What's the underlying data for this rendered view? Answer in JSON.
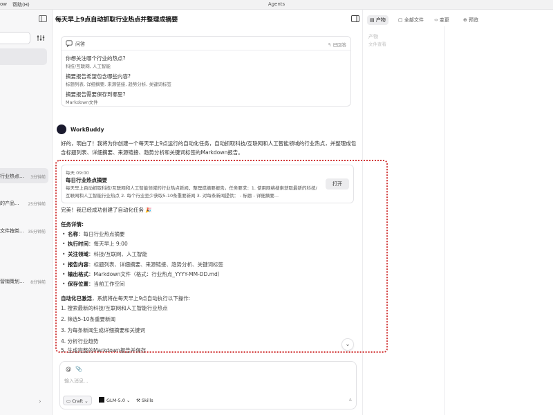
{
  "titlebar": {
    "menu_partial": "ow",
    "menu_help": "帮助(H)",
    "app_title": "Agents"
  },
  "sidebar": {
    "sessions": [
      {
        "title": "行业热点...",
        "time": "3分钟前",
        "active": true
      },
      {
        "title": "的产品...",
        "time": "25分钟前",
        "active": false
      },
      {
        "title": "文件按类...",
        "time": "35分钟前",
        "active": false
      },
      {
        "title": "营销策划...",
        "time": "8分钟前",
        "active": false
      }
    ]
  },
  "main": {
    "title": "每天早上9点自动抓取行业热点并整理成摘要",
    "qa": {
      "label": "问答",
      "answered": "已回答",
      "items": [
        {
          "q": "你想关注哪个行业的热点?",
          "a": "科技/互联网, 人工智能"
        },
        {
          "q": "摘要报告希望包含哪些内容?",
          "a": "标题列表, 详细摘要, 来源链接, 趋势分析, 关键词标签"
        },
        {
          "q": "摘要报告需要保存到哪里?",
          "a": "Markdown文件"
        }
      ]
    },
    "bot": {
      "name": "WorkBuddy",
      "intro": "好的，明白了！我将为你创建一个每天早上9点运行的自动化任务，自动抓取科技/互联网和人工智能领域的行业热点，并整理成包含标题列表、详细摘要、来源链接、趋势分析和关键词标签的Markdown报告。"
    },
    "task_card": {
      "time": "每天 09:00",
      "name": "每日行业热点摘要",
      "desc": "每天早上自动抓取科技/互联网和人工智能领域的行业热点新闻，整理成摘要报告。任务要求：1. 使用网络搜索获取最新的科技/互联网和人工智能行业热点 2. 每个行业至少获取5-10条重要新闻 3. 对每条新闻提供： - 标题 - 详细摘要...",
      "open_label": "打开"
    },
    "done_line": "完美！我已经成功创建了自动化任务 🎉",
    "details_title": "任务详情:",
    "details": [
      {
        "k": "名称",
        "v": "：每日行业热点摘要"
      },
      {
        "k": "执行时间",
        "v": "：每天早上 9:00"
      },
      {
        "k": "关注领域",
        "v": "：科技/互联网、人工智能"
      },
      {
        "k": "报告内容",
        "v": "：标题列表、详细摘要、来源链接、趋势分析、关键词标签"
      },
      {
        "k": "输出格式",
        "v": "：Markdown文件（格式：行业热点_YYYY-MM-DD.md）"
      },
      {
        "k": "保存位置",
        "v": "：当前工作空间"
      }
    ],
    "auto_bold": "自动化已激活",
    "auto_rest": "，系统将在每天早上9点自动执行以下操作:",
    "steps": [
      "1. 搜索最新的科技/互联网和人工智能行业热点",
      "2. 筛选5-10条重要新闻",
      "3. 为每条新闻生成详细摘要和关键词",
      "4. 分析行业趋势",
      "5. 生成完整的Markdown报告并保存"
    ],
    "input": {
      "placeholder": "输入消息...",
      "craft": "Craft",
      "model": "GLM-5.0",
      "skills": "Skills"
    }
  },
  "right_panel": {
    "tabs": [
      "产物",
      "全部文件",
      "变更",
      "预览"
    ],
    "label": "产物",
    "sub": "文件查看"
  }
}
